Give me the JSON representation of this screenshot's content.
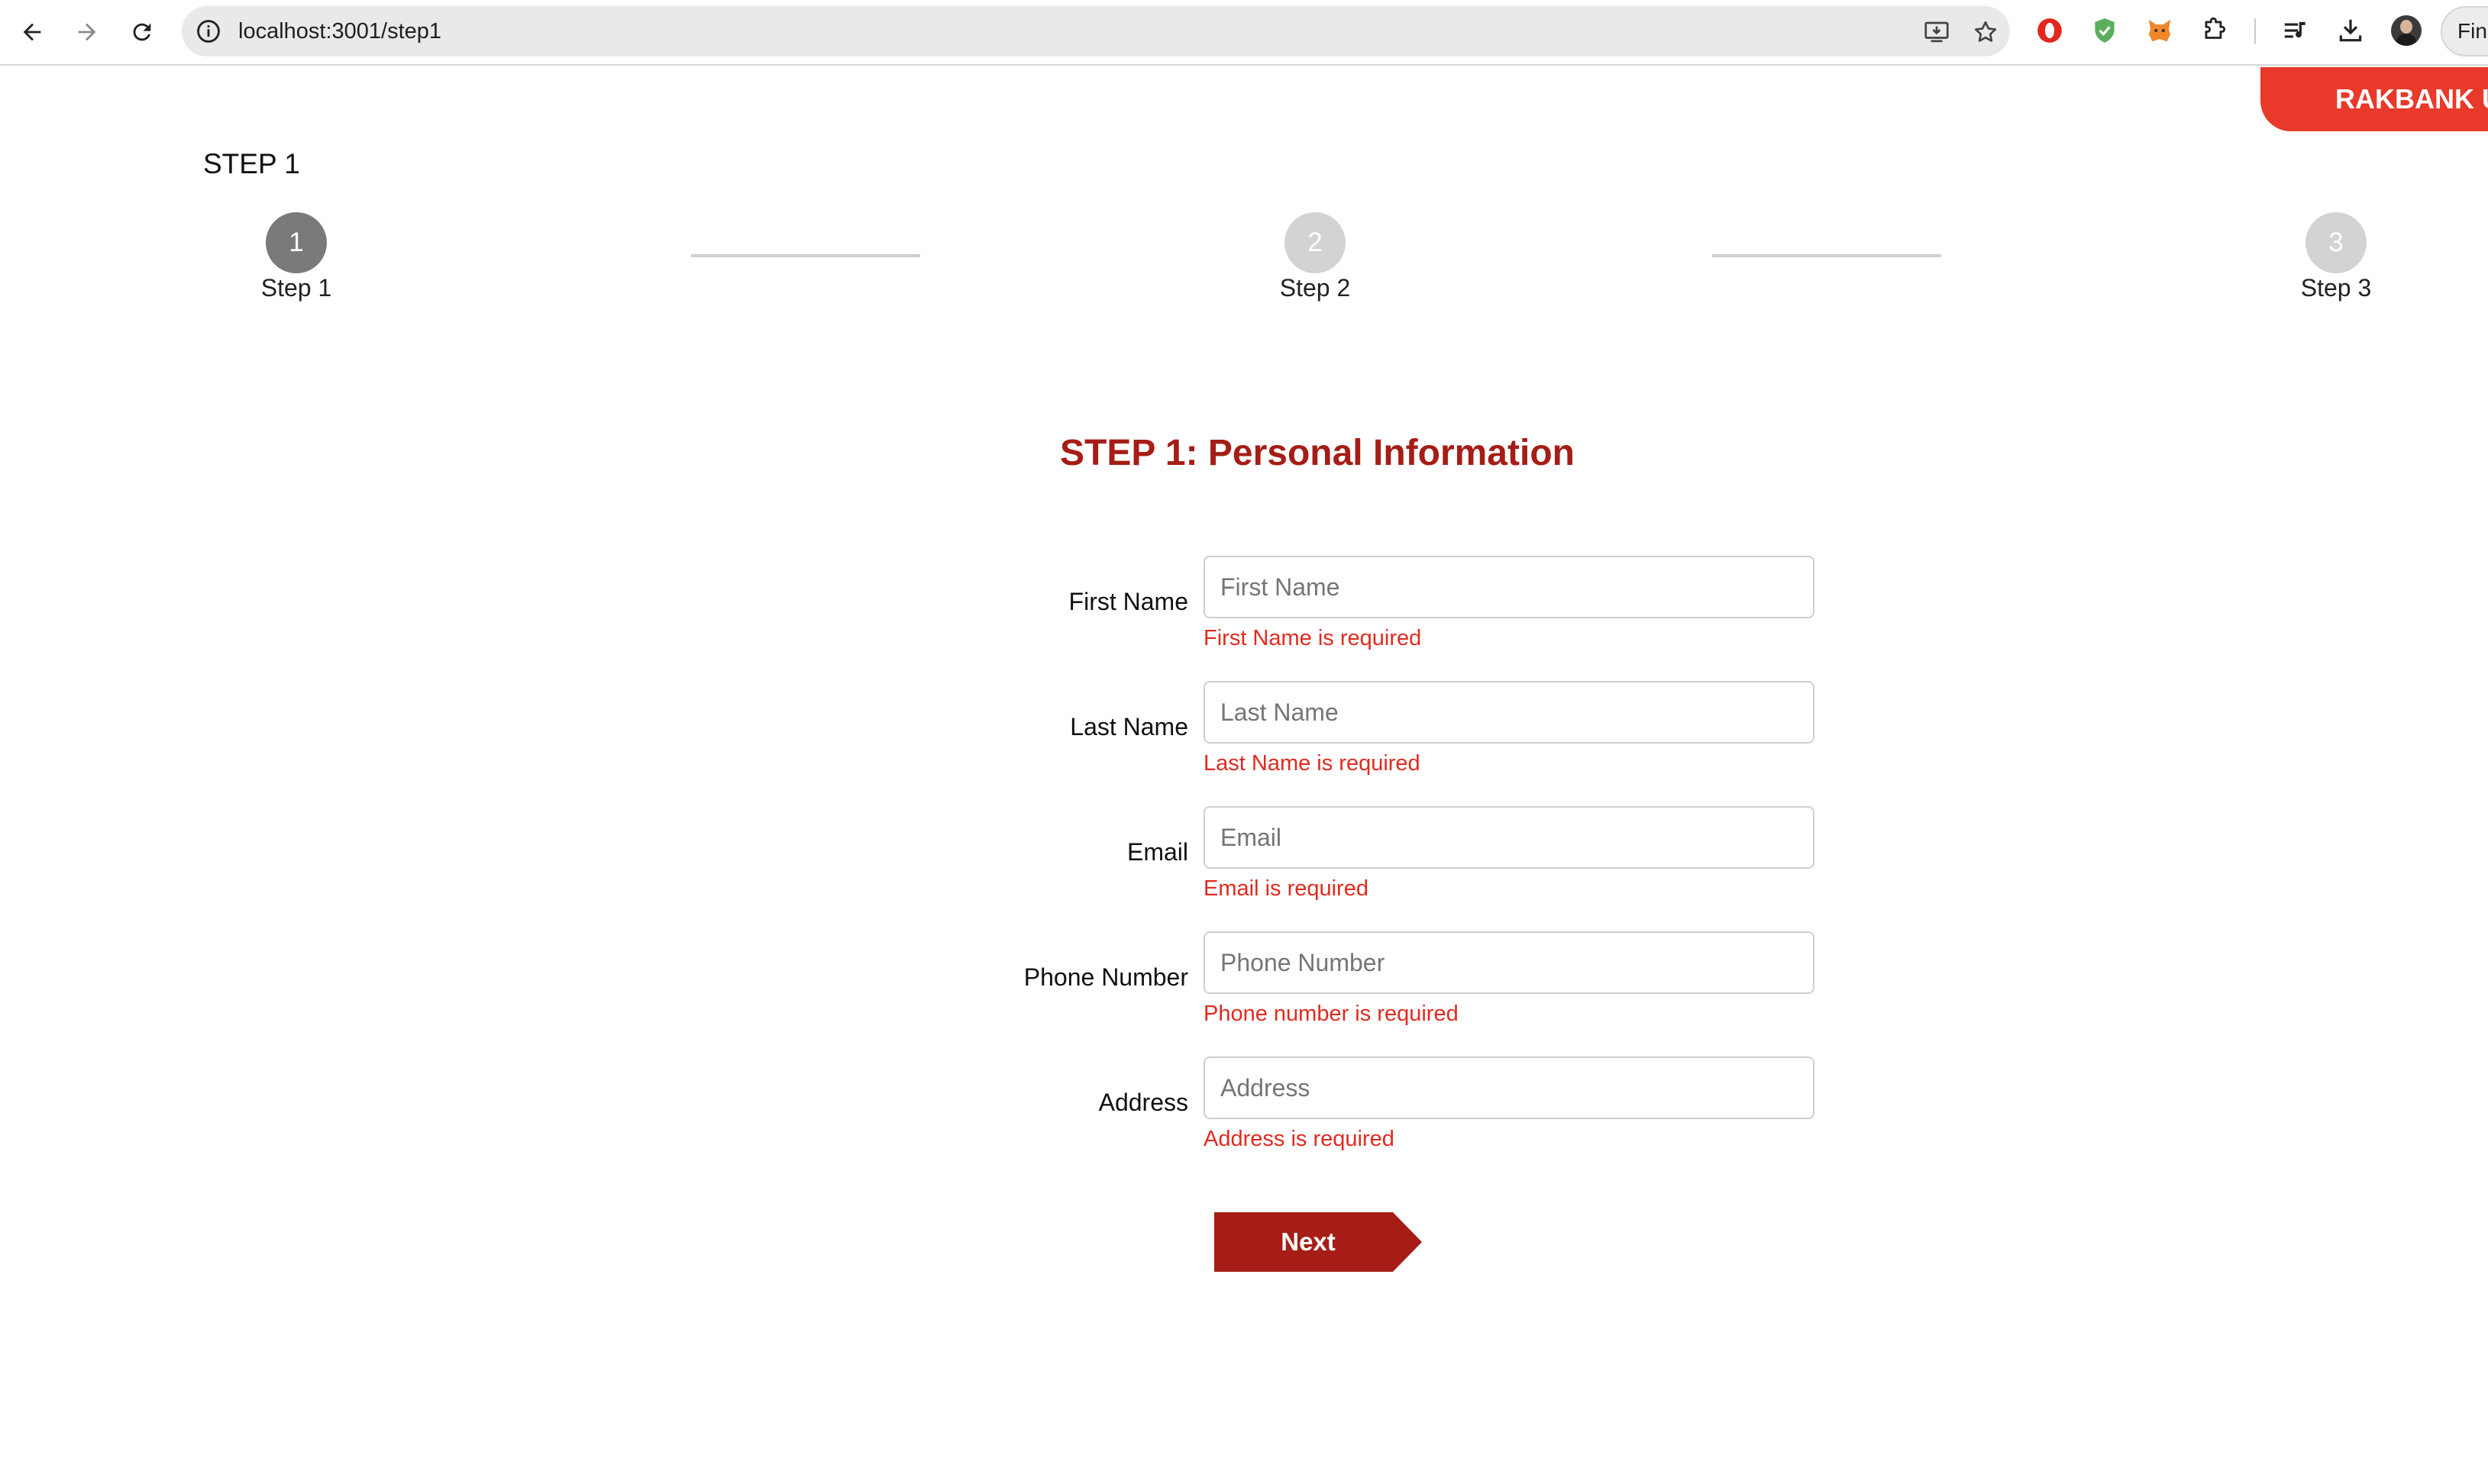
{
  "browser": {
    "url": "localhost:3001/step1",
    "profile_pill": "Fin"
  },
  "brand": {
    "label": "RAKBANK U",
    "color": "#e8392b"
  },
  "page": {
    "heading": "STEP 1"
  },
  "stepper": {
    "steps": [
      {
        "number": "1",
        "label": "Step 1",
        "active": true
      },
      {
        "number": "2",
        "label": "Step 2",
        "active": false
      },
      {
        "number": "3",
        "label": "Step 3",
        "active": false
      }
    ]
  },
  "form": {
    "title": "STEP 1: Personal Information",
    "title_color": "#a51d16",
    "fields": [
      {
        "label": "First Name",
        "placeholder": "First Name",
        "value": "",
        "error": "First Name is required"
      },
      {
        "label": "Last Name",
        "placeholder": "Last Name",
        "value": "",
        "error": "Last Name is required"
      },
      {
        "label": "Email",
        "placeholder": "Email",
        "value": "",
        "error": "Email is required"
      },
      {
        "label": "Phone Number",
        "placeholder": "Phone Number",
        "value": "",
        "error": "Phone number is required"
      },
      {
        "label": "Address",
        "placeholder": "Address",
        "value": "",
        "error": "Address is required"
      }
    ],
    "next_label": "Next",
    "error_color": "#e02b20"
  },
  "icons": {
    "back": "arrow-left-icon",
    "forward": "arrow-right-icon",
    "reload": "reload-icon",
    "site_info": "info-icon",
    "install": "install-app-icon",
    "bookmark": "star-icon",
    "extensions": [
      "opera-icon",
      "shield-check-icon",
      "fox-icon",
      "puzzle-icon",
      "media-queue-icon",
      "download-icon"
    ]
  }
}
